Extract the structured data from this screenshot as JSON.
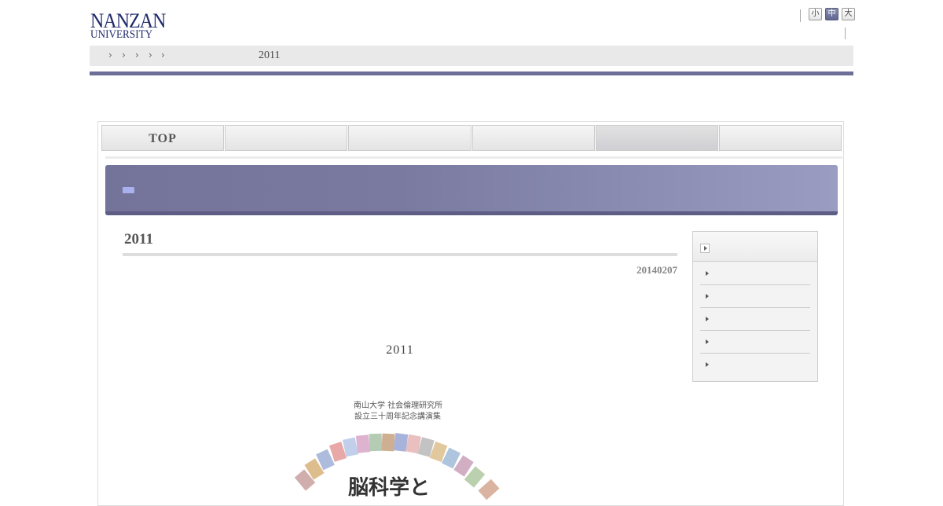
{
  "header": {
    "logo_line1": "NANZAN",
    "logo_line2": "UNIVERSITY",
    "font_size_buttons": [
      "小",
      "中",
      "大"
    ],
    "font_size_selected": "中"
  },
  "breadcrumb": {
    "separator_icon": "chevron-right-icon",
    "current": "2011"
  },
  "nav": {
    "tabs": [
      {
        "label": "TOP"
      },
      {
        "label": ""
      },
      {
        "label": ""
      },
      {
        "label": ""
      },
      {
        "label": ""
      },
      {
        "label": ""
      }
    ],
    "active_index": 4
  },
  "article": {
    "title": "2011",
    "date": "20140207",
    "body_year": "2011",
    "book_cover": {
      "line1": "南山大学 社会倫理研究所",
      "line2": "設立三十周年記念講演集",
      "main_title": "脳科学と"
    }
  },
  "colors": {
    "accent": "#6e6f98",
    "banner_start": "#74749a",
    "banner_end": "#9a9cc1",
    "logo": "#1f2a6b"
  }
}
